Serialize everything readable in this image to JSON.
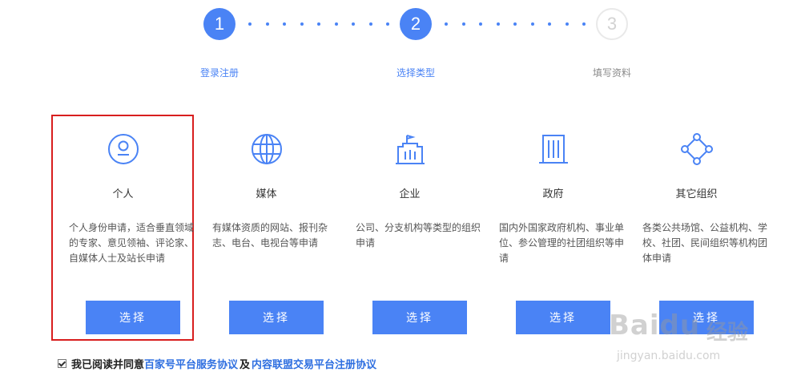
{
  "steps": [
    {
      "number": "1",
      "label": "登录注册",
      "state": "active"
    },
    {
      "number": "2",
      "label": "选择类型",
      "state": "active"
    },
    {
      "number": "3",
      "label": "填写资料",
      "state": "inactive"
    }
  ],
  "colors": {
    "accent": "#4a83f5",
    "highlight": "#d81e1e",
    "link": "#2f6fe0"
  },
  "cards": [
    {
      "icon": "person-icon",
      "title": "个人",
      "desc": "个人身份申请，适合垂直领域的专家、意见领袖、评论家、自媒体人士及站长申请",
      "button": "选择"
    },
    {
      "icon": "globe-icon",
      "title": "媒体",
      "desc": "有媒体资质的网站、报刊杂志、电台、电视台等申请",
      "button": "选择"
    },
    {
      "icon": "building-icon",
      "title": "企业",
      "desc": "公司、分支机构等类型的组织申请",
      "button": "选择"
    },
    {
      "icon": "government-building-icon",
      "title": "政府",
      "desc": "国内外国家政府机构、事业单位、参公管理的社团组织等申请",
      "button": "选择"
    },
    {
      "icon": "network-icon",
      "title": "其它组织",
      "desc": "各类公共场馆、公益机构、学校、社团、民间组织等机构团体申请",
      "button": "选择"
    }
  ],
  "agreement": {
    "checked": true,
    "prefix": "我已阅读并同意",
    "link1": "百家号平台服务协议",
    "middle": "及",
    "link2": "内容联盟交易平台注册协议"
  },
  "watermark": {
    "brand": "Baidu",
    "cn": "经验",
    "url": "jingyan.baidu.com"
  }
}
